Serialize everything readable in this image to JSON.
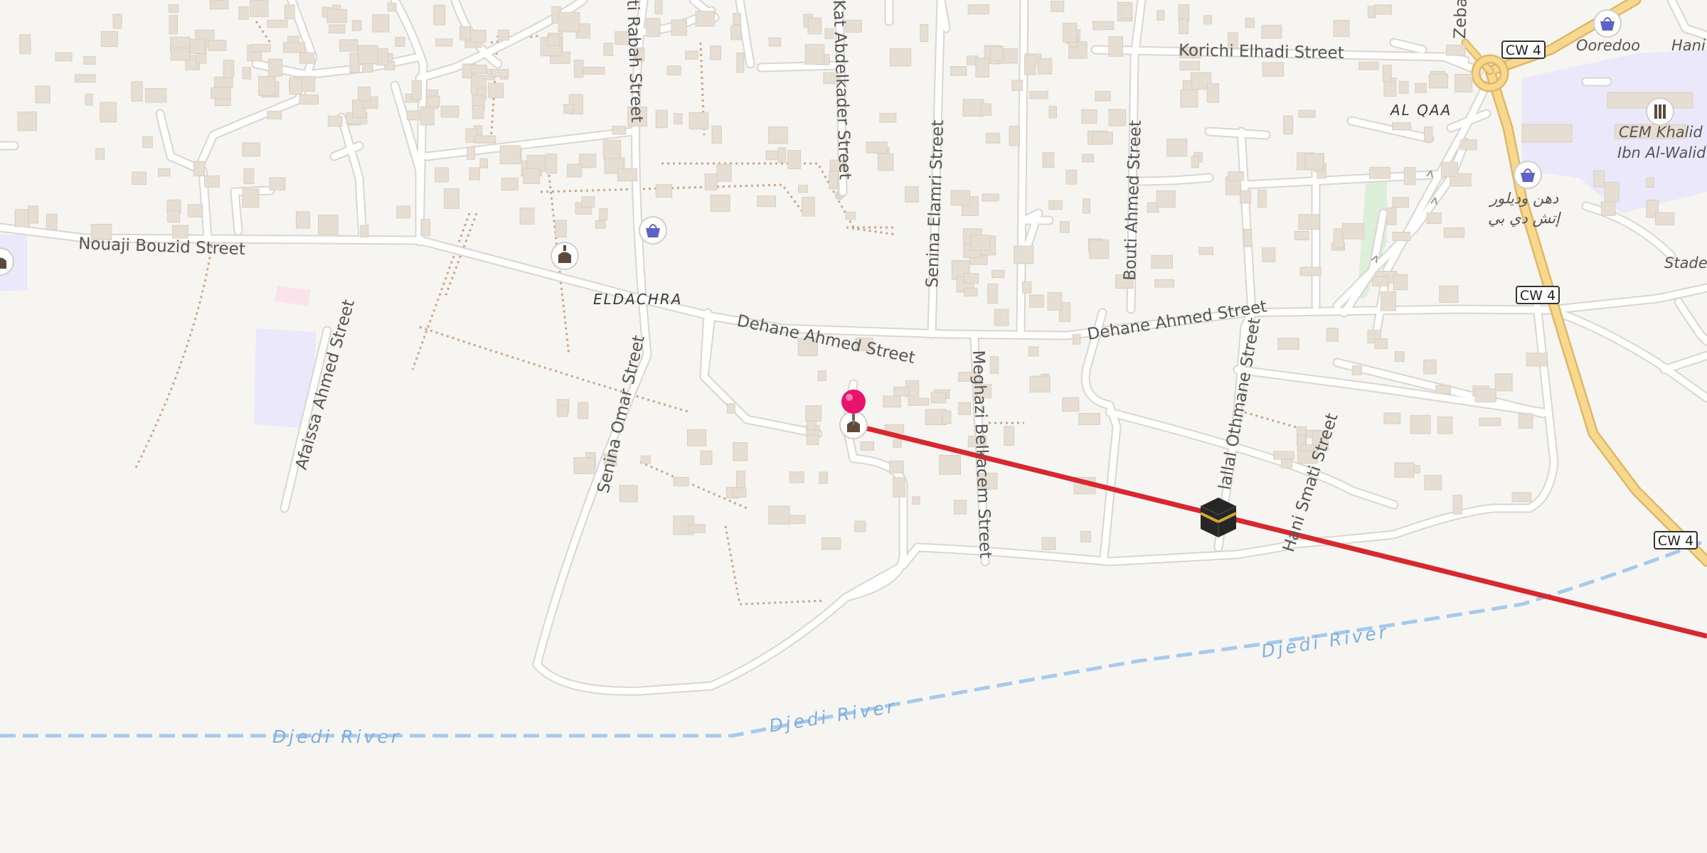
{
  "map": {
    "streets": [
      "Nouaji Bouzid Street",
      "Dehane Ahmed Street",
      "Dehane Ahmed Street",
      "Korichi Elhadi Street",
      "Senina Omar Street",
      "Afaissa Ahmed Street",
      "Meghazi Belkacem Street",
      "Senina Elamri Street",
      "Bouti Ahmed Street",
      "Kat Abdelkader Street",
      "ti Rabah Street",
      "Hani Smati Street",
      "lallal Othmane Street",
      "Zeba"
    ],
    "places": {
      "eldachra": "ELDACHRA",
      "al_qaa": "AL QAA",
      "ooredoo": "Ooredoo",
      "cem_line1": "CEM Khalid",
      "cem_line2": "Ibn Al-Walid",
      "stade": "Stade",
      "hani": "Hani",
      "shop_line1": "دهن وديلور",
      "shop_line2": "إتش دي بي"
    },
    "river": "Djedi River",
    "route_shield": "CW 4",
    "colors": {
      "background": "#f7f5f2",
      "road": "#ffffff",
      "road_casing": "#d9d6d1",
      "primary_road": "#f6d88f",
      "route_line": "#d8282f",
      "river": "#a6c9ec",
      "path": "#c8a687",
      "building": "#e6ddd3",
      "school_area": "#ece8fb",
      "pin": "#e8136a"
    },
    "markers": {
      "pin": "location-pin-icon",
      "qibla": "kaaba-icon",
      "mosques": "mosque-icon",
      "shops": "shopping-bag-icon",
      "school": "school-icon"
    }
  }
}
